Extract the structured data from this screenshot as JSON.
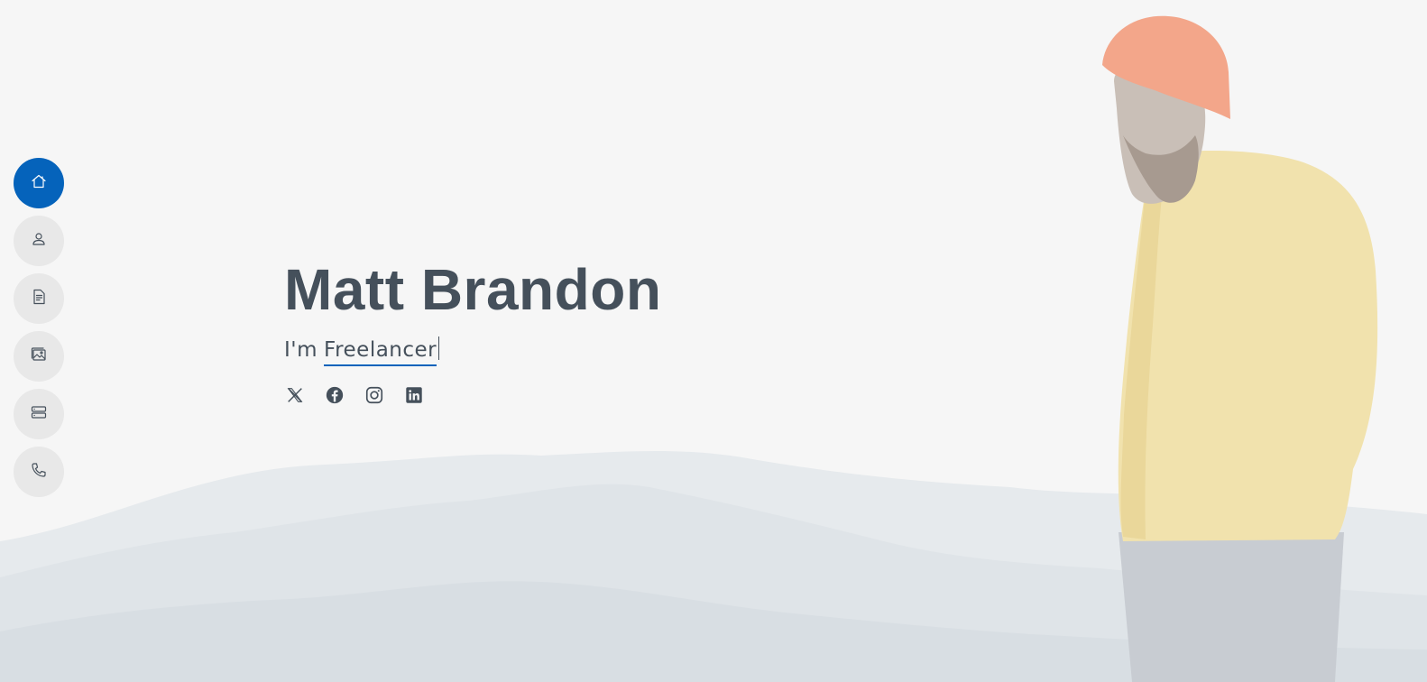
{
  "nav": {
    "items": [
      {
        "icon": "home-icon",
        "active": true
      },
      {
        "icon": "person-icon",
        "active": false
      },
      {
        "icon": "file-text-icon",
        "active": false
      },
      {
        "icon": "images-icon",
        "active": false
      },
      {
        "icon": "server-icon",
        "active": false
      },
      {
        "icon": "phone-icon",
        "active": false
      }
    ]
  },
  "hero": {
    "name": "Matt Brandon",
    "prefix": "I'm",
    "typed_text": "Freelancer"
  },
  "social": [
    {
      "icon": "x-twitter-icon"
    },
    {
      "icon": "facebook-icon"
    },
    {
      "icon": "instagram-icon"
    },
    {
      "icon": "linkedin-icon"
    }
  ],
  "colors": {
    "accent": "#0563bb",
    "text": "#45505b",
    "nav_bg": "#e8e8e8"
  }
}
